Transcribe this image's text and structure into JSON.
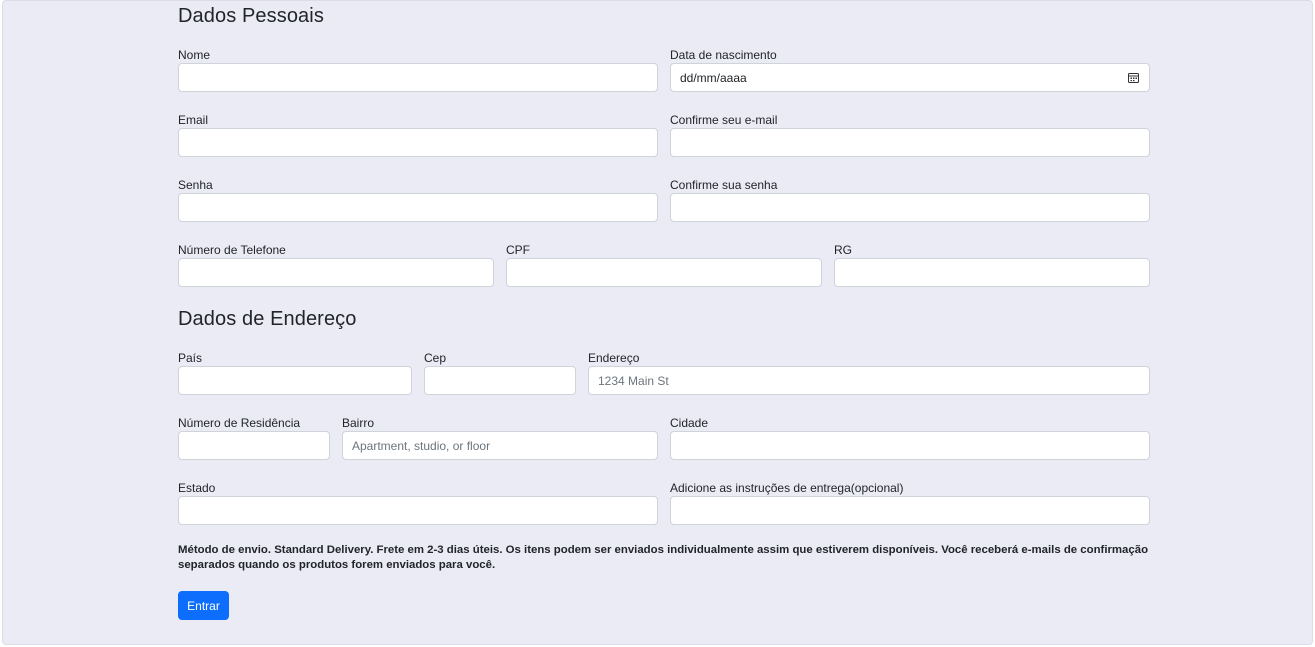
{
  "personal": {
    "title": "Dados Pessoais",
    "nome_label": "Nome",
    "nome_value": "",
    "nascimento_label": "Data de nascimento",
    "nascimento_value": "dd/mm/aaaa",
    "email_label": "Email",
    "email_value": "",
    "confirm_email_label": "Confirme seu e-mail",
    "confirm_email_value": "",
    "senha_label": "Senha",
    "senha_value": "",
    "confirm_senha_label": "Confirme sua senha",
    "confirm_senha_value": "",
    "telefone_label": "Número de Telefone",
    "telefone_value": "",
    "cpf_label": "CPF",
    "cpf_value": "",
    "rg_label": "RG",
    "rg_value": ""
  },
  "address": {
    "title": "Dados de Endereço",
    "pais_label": "País",
    "pais_value": "",
    "cep_label": "Cep",
    "cep_value": "",
    "endereco_label": "Endereço",
    "endereco_placeholder": "1234 Main St",
    "numero_label": "Número de Residência",
    "numero_value": "",
    "bairro_label": "Bairro",
    "bairro_placeholder": "Apartment, studio, or floor",
    "cidade_label": "Cidade",
    "cidade_value": "",
    "estado_label": "Estado",
    "estado_value": "",
    "instrucoes_label": "Adicione as instruções de entrega(opcional)",
    "instrucoes_value": ""
  },
  "shipping_note": "Método de envio. Standard Delivery. Frete em 2-3 dias úteis. Os itens podem ser enviados individualmente assim que estiverem disponíveis. Você receberá e-mails de confirmação separados quando os produtos forem enviados para você.",
  "submit_label": "Entrar",
  "colors": {
    "background": "#ebebf5",
    "primary": "#0d6efd",
    "input_border": "#ced4da"
  },
  "icons": {
    "date_picker": "calendar-icon"
  }
}
